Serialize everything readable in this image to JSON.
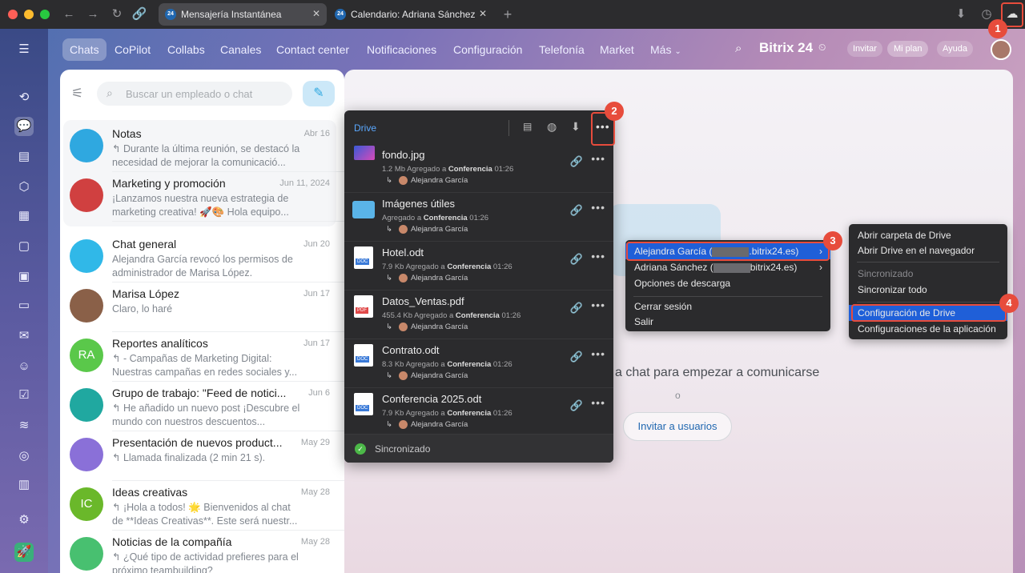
{
  "browser": {
    "tabs": [
      {
        "label": "Mensajería Instantánea",
        "badge": "24"
      },
      {
        "label": "Calendario: Adriana Sánchez",
        "badge": "24"
      }
    ],
    "new_tab": "+"
  },
  "nav": {
    "items": [
      "Chats",
      "CoPilot",
      "Collabs",
      "Canales",
      "Contact center",
      "Notificaciones",
      "Configuración",
      "Telefonía",
      "Market",
      "Más"
    ],
    "logo": "Bitrix 24",
    "invite": "Invitar",
    "plan": "Mi plan",
    "help": "Ayuda"
  },
  "search": {
    "placeholder": "Buscar un empleado o chat"
  },
  "chats": [
    {
      "name": "Notas",
      "date": "Abr 16",
      "preview": "↰ Durante la última reunión, se destacó la necesidad de mejorar la comunicació...",
      "initials": "",
      "color": "#2fa8e0"
    },
    {
      "name": "Marketing y promoción",
      "date": "Jun 11, 2024",
      "preview": "¡Lanzamos nuestra nueva estrategia de marketing creativa! 🚀🎨 Hola equipo...",
      "initials": "",
      "color": "#d04040"
    },
    {
      "name": "Chat general",
      "date": "Jun 20",
      "preview": "Alejandra García revocó los permisos de administrador de Marisa López.",
      "initials": "",
      "color": "#30b8e8"
    },
    {
      "name": "Marisa López",
      "date": "Jun 17",
      "preview": "Claro, lo haré",
      "initials": "",
      "color": "#8a6048"
    },
    {
      "name": "Reportes analíticos",
      "date": "Jun 17",
      "preview": "↰ - Campañas de Marketing Digital: Nuestras campañas en redes sociales y...",
      "initials": "RA",
      "color": "#5ac84a"
    },
    {
      "name": "Grupo de trabajo: \"Feed de notici...",
      "date": "Jun 6",
      "preview": "↰ He añadido un nuevo post ¡Descubre el mundo con nuestros descuentos...",
      "initials": "",
      "color": "#20a8a0"
    },
    {
      "name": "Presentación de nuevos product...",
      "date": "May 29",
      "preview": "↰ Llamada finalizada (2 min 21 s).",
      "initials": "",
      "color": "#8a70d8"
    },
    {
      "name": "Ideas creativas",
      "date": "May 28",
      "preview": "↰ ¡Hola a todos! 🌟 Bienvenidos al chat de **Ideas Creativas**. Este será nuestr...",
      "initials": "IC",
      "color": "#6ab82a"
    },
    {
      "name": "Noticias de la compañía",
      "date": "May 28",
      "preview": "↰ ¿Qué tipo de actividad prefieres para el próximo teambuilding?",
      "initials": "",
      "color": "#48c070"
    }
  ],
  "drive": {
    "title": "Drive",
    "files": [
      {
        "name": "fondo.jpg",
        "meta_prefix": "1.2 Mb Agregado a ",
        "meta_bold": "Conferencia",
        "meta_time": " 01:26",
        "user": "Alejandra García",
        "type": "img"
      },
      {
        "name": "Imágenes útiles",
        "meta_prefix": "Agregado a ",
        "meta_bold": "Conferencia",
        "meta_time": " 01:26",
        "user": "Alejandra García",
        "type": "folder"
      },
      {
        "name": "Hotel.odt",
        "meta_prefix": "7.9 Kb Agregado a ",
        "meta_bold": "Conferencia",
        "meta_time": " 01:26",
        "user": "Alejandra García",
        "type": "DOC"
      },
      {
        "name": "Datos_Ventas.pdf",
        "meta_prefix": "455.4 Kb Agregado a ",
        "meta_bold": "Conferencia",
        "meta_time": " 01:26",
        "user": "Alejandra García",
        "type": "PDF"
      },
      {
        "name": "Contrato.odt",
        "meta_prefix": "8.3 Kb Agregado a ",
        "meta_bold": "Conferencia",
        "meta_time": " 01:26",
        "user": "Alejandra García",
        "type": "DOC"
      },
      {
        "name": "Conferencia 2025.odt",
        "meta_prefix": "7.9 Kb Agregado a ",
        "meta_bold": "Conferencia",
        "meta_time": " 01:26",
        "user": "Alejandra García",
        "type": "DOC"
      }
    ],
    "status": "Sincronizado"
  },
  "account_menu": {
    "items": [
      "Alejandra García (",
      ".bitrix24.es)",
      "Adriana Sánchez (",
      "bitrix24.es)",
      "Opciones de descarga",
      "Cerrar sesión",
      "Salir"
    ]
  },
  "settings_menu": {
    "items": [
      "Abrir carpeta de Drive",
      "Abrir Drive en el navegador",
      "Sincronizado",
      "Sincronizar todo",
      "Configuración de Drive",
      "Configuraciones de la aplicación"
    ]
  },
  "center": {
    "message": "a chat para empezar a comunicarse",
    "or": "o",
    "invite_button": "Invitar a usuarios"
  },
  "callouts": [
    "1",
    "2",
    "3",
    "4"
  ],
  "colors": {
    "accent": "#2067b0",
    "callout": "#e74c3c",
    "highlight": "#1f5fd8"
  }
}
